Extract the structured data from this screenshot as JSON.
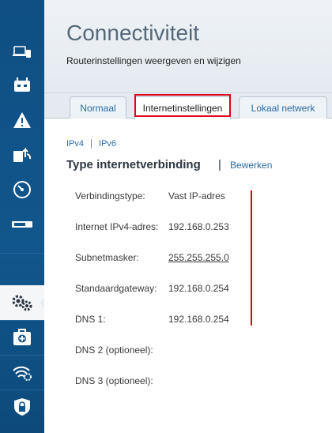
{
  "header": {
    "title": "Connectiviteit",
    "subtitle": "Routerinstellingen weergeven en wijzigen"
  },
  "tabs": [
    {
      "label": "Normaal",
      "active": false
    },
    {
      "label": "Internetinstellingen",
      "active": true
    },
    {
      "label": "Lokaal netwerk",
      "active": false
    }
  ],
  "subnav": {
    "ipv4": "IPv4",
    "ipv6": "IPv6"
  },
  "section": {
    "title": "Type internetverbinding",
    "separator": "|",
    "edit": "Bewerken"
  },
  "rows": [
    {
      "label": "Verbindingstype:",
      "value": "Vast IP-adres"
    },
    {
      "label": "Internet IPv4-adres:",
      "value": "192.168.0.253"
    },
    {
      "label": "Subnetmasker:",
      "value": "255.255.255.0"
    },
    {
      "label": "Standaardgateway:",
      "value": "192.168.0.254"
    },
    {
      "label": "DNS 1:",
      "value": "192.168.0.254"
    },
    {
      "label": "DNS 2 (optioneel):",
      "value": ""
    },
    {
      "label": "DNS 3 (optioneel):",
      "value": ""
    }
  ],
  "sidebar": {
    "icons": [
      "devices-icon",
      "router-icon",
      "warning-icon",
      "updates-icon",
      "speed-gauge-icon",
      "usb-icon",
      "settings-gears-icon",
      "first-aid-icon",
      "wifi-settings-icon",
      "security-shield-icon"
    ],
    "active_icon": "settings-gears-icon"
  },
  "colors": {
    "accent": "#2b6aa7",
    "sidebar": "#11568c",
    "highlight": "#e0001a"
  }
}
